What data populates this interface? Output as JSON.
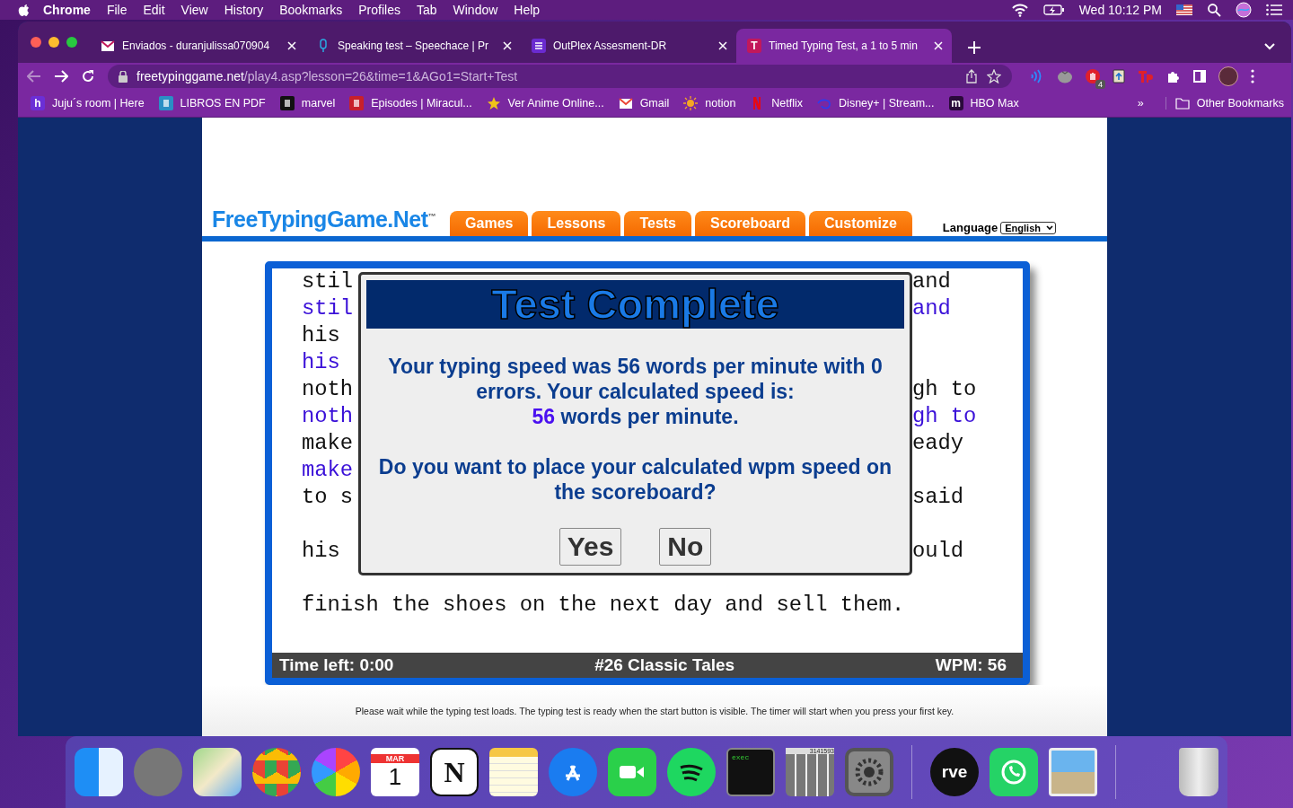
{
  "menu_bar": {
    "app": "Chrome",
    "items": [
      "File",
      "Edit",
      "View",
      "History",
      "Bookmarks",
      "Profiles",
      "Tab",
      "Window",
      "Help"
    ],
    "clock": "Wed 10:12 PM"
  },
  "tabs": [
    {
      "title": "Enviados - duranjulissa070904",
      "selected": false
    },
    {
      "title": "Speaking test – Speechace | Pr",
      "selected": false
    },
    {
      "title": "OutPlex Assesment-DR",
      "selected": false
    },
    {
      "title": "Timed Typing Test, a 1 to 5 min",
      "letter": "T",
      "selected": true
    }
  ],
  "address_bar": {
    "host": "freetypinggame.net",
    "path": "/play4.asp?lesson=26&time=1&AGo1=Start+Test"
  },
  "extension_badge": "4",
  "bookmarks": [
    {
      "label": "Juju´s room | Here",
      "letter": "h"
    },
    {
      "label": "LIBROS EN PDF"
    },
    {
      "label": "marvel"
    },
    {
      "label": "Episodes | Miracul..."
    },
    {
      "label": "Ver Anime Online..."
    },
    {
      "label": "Gmail"
    },
    {
      "label": "notion"
    },
    {
      "label": "Netflix"
    },
    {
      "label": "Disney+ | Stream..."
    },
    {
      "label": "HBO Max",
      "letter": "m"
    }
  ],
  "bookmarks_more": "»",
  "other_bookmarks": "Other Bookmarks",
  "site": {
    "logo": "FreeTypingGame.Net",
    "logo_mark": "™",
    "nav": [
      "Games",
      "Lessons",
      "Tests",
      "Scoreboard",
      "Customize"
    ],
    "language_label": "Language",
    "language_value": "English",
    "paragraphs": [
      [
        {
          "left": "stil",
          "right": "and",
          "typed": false
        },
        {
          "left": "stil",
          "right": "and",
          "typed": true
        },
        {
          "left": "his",
          "typed": false
        },
        {
          "left": "his",
          "typed": true
        },
        {
          "left": "noth",
          "right": "gh to",
          "typed": false
        },
        {
          "left": "noth",
          "right": "gh to",
          "typed": true
        },
        {
          "left": "make",
          "right": "eady",
          "typed": false
        },
        {
          "left": "make",
          "typed": true
        },
        {
          "left": "to s",
          "right": "said",
          "typed": false
        }
      ],
      [
        {
          "left": "his",
          "right": "ould",
          "typed": false
        }
      ],
      [
        {
          "left": "finish the shoes on the next day and sell them.",
          "typed": false
        }
      ]
    ],
    "dialog": {
      "title": "Test Complete",
      "message": "Your typing speed was 56 words per minute with 0 errors. Your calculated speed is:",
      "speed_value": "56",
      "speed_unit": "words per minute.",
      "question": "Do you want to place your calculated wpm speed on the scoreboard?",
      "buttons": [
        "Yes",
        "No"
      ]
    },
    "status": {
      "time_left": "Time left: 0:00",
      "lesson": "#26 Classic Tales",
      "wpm": "WPM: 56"
    },
    "footer": "Please wait while the typing test loads. The typing test is ready when the start button is visible. The timer will start when you press your first key."
  },
  "dock": {
    "calendar_month": "MAR",
    "calendar_day": "1",
    "notion_letter": "N",
    "terminal_text": "exec",
    "calculator_display": "3141593",
    "rave_text": "rve"
  }
}
